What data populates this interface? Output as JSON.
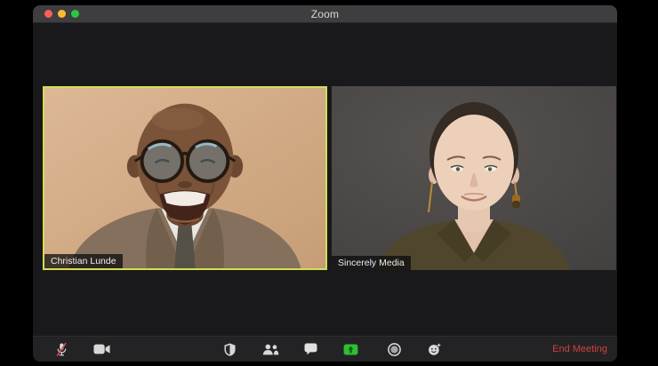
{
  "window": {
    "title": "Zoom",
    "traffic_lights": [
      "close",
      "minimize",
      "fullscreen"
    ]
  },
  "participants": [
    {
      "name": "Christian Lunde",
      "active_speaker": true
    },
    {
      "name": "Sincerely Media",
      "active_speaker": false
    }
  ],
  "toolbar": {
    "buttons": [
      {
        "icon": "microphone-muted-icon",
        "state": "muted"
      },
      {
        "icon": "video-camera-icon",
        "state": "on"
      },
      {
        "icon": "security-shield-icon"
      },
      {
        "icon": "participants-icon"
      },
      {
        "icon": "chat-icon"
      },
      {
        "icon": "share-screen-icon"
      },
      {
        "icon": "record-icon"
      },
      {
        "icon": "reactions-icon"
      }
    ],
    "end_meeting_label": "End Meeting"
  },
  "colors": {
    "active_speaker_border": "#d3de55",
    "share_screen_green": "#2fbe33",
    "end_meeting_red": "#ce4040",
    "traffic_red": "#ff5f57",
    "traffic_yellow": "#fdbc2f",
    "traffic_green": "#27c93f"
  }
}
